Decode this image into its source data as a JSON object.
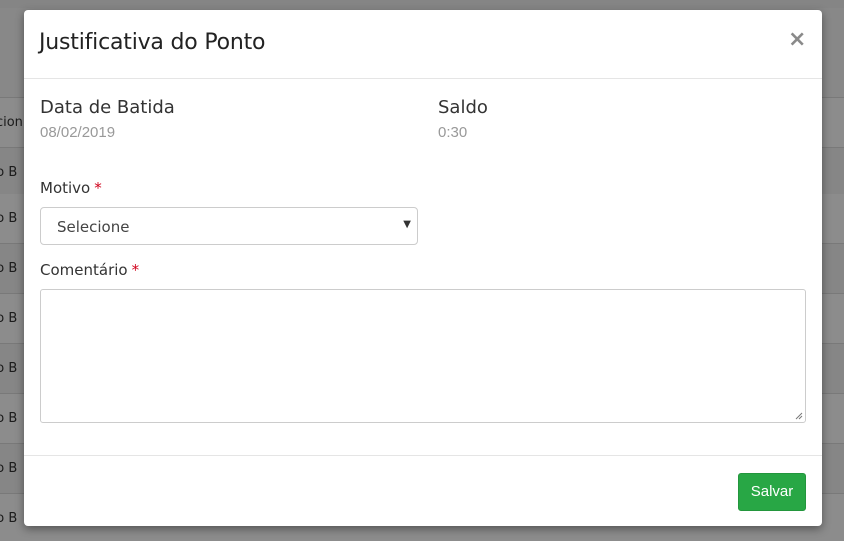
{
  "background": {
    "rows": [
      "acion",
      "no B",
      "no B",
      "no B",
      "no B",
      "no B",
      "no B",
      "no B",
      "no B"
    ]
  },
  "modal": {
    "title": "Justificativa do Ponto",
    "close_label": "×",
    "info": {
      "date_label": "Data de Batida",
      "date_value": "08/02/2019",
      "balance_label": "Saldo",
      "balance_value": "0:30"
    },
    "form": {
      "reason_label": "Motivo",
      "reason_required": "*",
      "reason_selected": "Selecione",
      "comment_label": "Comentário",
      "comment_required": "*",
      "comment_value": ""
    },
    "footer": {
      "save_label": "Salvar"
    }
  },
  "colors": {
    "save_button": "#28a745",
    "required_marker": "#d0021b",
    "muted_value": "#999999"
  },
  "icons": {
    "close": "close-icon",
    "dropdown": "caret-down-icon"
  }
}
